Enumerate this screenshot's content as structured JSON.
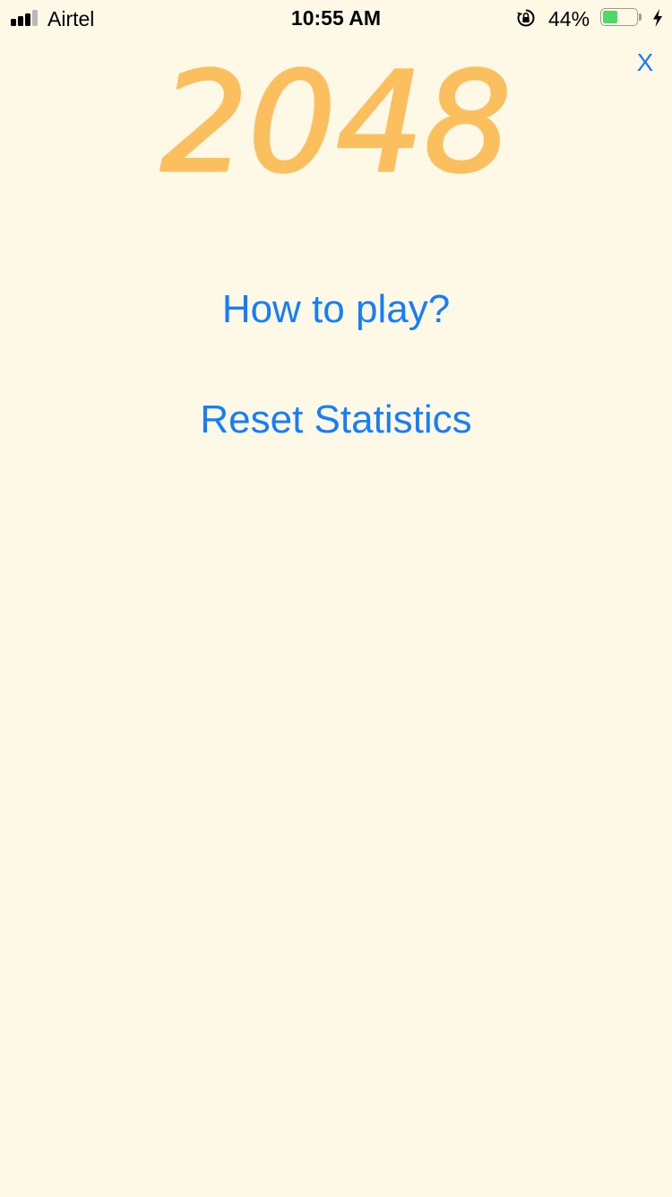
{
  "status_bar": {
    "carrier": "Airtel",
    "time": "10:55 AM",
    "battery_percent": "44%",
    "battery_level": 0.44,
    "signal_bars_total": 4,
    "signal_bars_active": 3,
    "icons": [
      "signal-strength-icon",
      "orientation-lock-icon",
      "battery-icon",
      "charging-bolt-icon"
    ]
  },
  "close_label": "X",
  "logo_text": "2048",
  "menu": {
    "how_to_play": "How to play?",
    "reset_statistics": "Reset Statistics"
  },
  "colors": {
    "background": "#FEF8E7",
    "logo": "#FBBF5E",
    "link": "#147EFB",
    "battery_fill": "#4CD964"
  }
}
